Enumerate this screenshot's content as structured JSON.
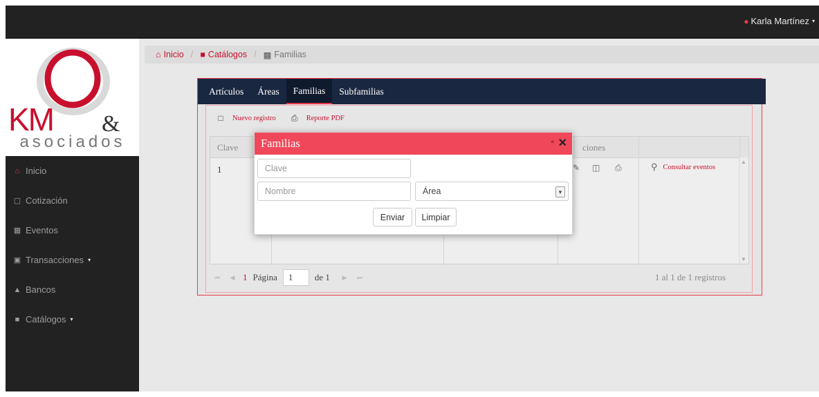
{
  "topbar": {
    "user_name": "Karla Martínez",
    "user_icon": "user-icon",
    "caret": "▾"
  },
  "logo": {
    "text": "asociados",
    "brand": "KM&"
  },
  "sidebar": {
    "items": [
      {
        "label": "Inicio",
        "icon": "home-icon"
      },
      {
        "label": "Cotización",
        "icon": "cart-icon"
      },
      {
        "label": "Eventos",
        "icon": "calendar-icon"
      },
      {
        "label": "Transacciones",
        "icon": "money-icon",
        "caret": "▾"
      },
      {
        "label": "Bancos",
        "icon": "bank-icon"
      },
      {
        "label": "Catálogos",
        "icon": "book-icon",
        "caret": "▾"
      }
    ]
  },
  "breadcrumb": {
    "home": "Inicio",
    "catalogs": "Catálogos",
    "current": "Familias"
  },
  "tabs": [
    "Artículos",
    "Áreas",
    "Familias",
    "Subfamilias"
  ],
  "toolbar": {
    "new_label": "Nuevo registro",
    "pdf_label": "Reporte PDF"
  },
  "grid": {
    "col_clave": "Clave",
    "col_acciones_partial": "ciones",
    "row_clave": "1",
    "consult_label": "Consultar eventos"
  },
  "pager": {
    "page_label": "Página",
    "current_page": "1",
    "page_value": "1",
    "of_label": "de 1",
    "info": "1 al 1 de 1 registros"
  },
  "modal": {
    "title": "Familias",
    "clave_placeholder": "Clave",
    "nombre_placeholder": "Nombre",
    "area_selected": "Área",
    "submit_label": "Enviar",
    "clear_label": "Limpiar"
  },
  "colors": {
    "accent": "#e8394a",
    "header_dark": "#222222",
    "tab_bar": "#1a2740",
    "modal_head": "#f0485a"
  }
}
